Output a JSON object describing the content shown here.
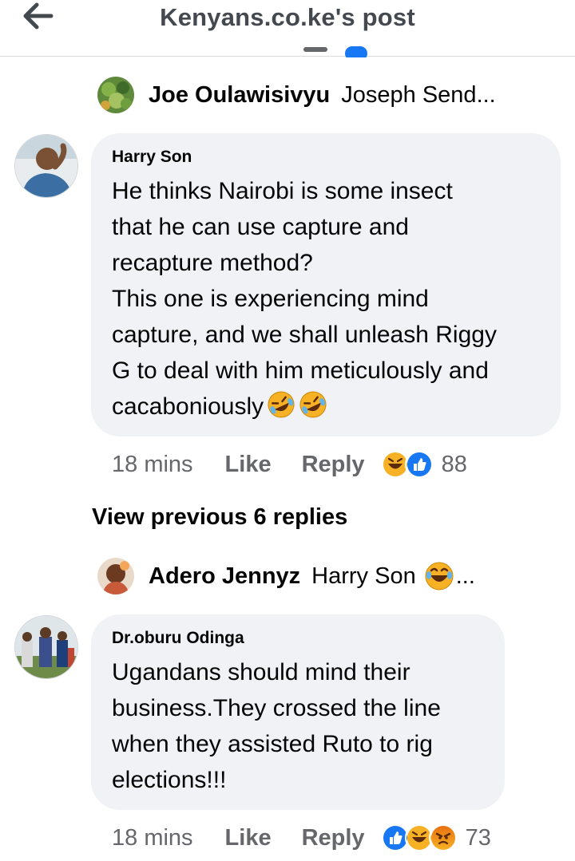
{
  "header": {
    "title": "Kenyans.co.ke's post",
    "back_icon": "arrow-left-icon"
  },
  "comments": [
    {
      "reply_preview": {
        "name": "Joe Oulawisivyu",
        "text": "Joseph Send..."
      },
      "author": "Harry Son",
      "text": "He thinks Nairobi is some insect\nthat he can use capture and\nrecapture method?\nThis one is experiencing mind\ncapture, and we shall unleash Riggy\nG to deal with him meticulously and\ncacaboniously",
      "time": "18 mins",
      "like_label": "Like",
      "reply_label": "Reply",
      "reaction_count": "88",
      "reactions": [
        "haha",
        "like"
      ]
    },
    {
      "reply_preview": {
        "name": "Adero Jennyz",
        "text": "Harry Son",
        "ellipsis": "..."
      },
      "author": "Dr.oburu Odinga",
      "text": "Ugandans should mind their\nbusiness.They crossed the line\nwhen they assisted Ruto to rig\nelections!!!",
      "time": "18 mins",
      "like_label": "Like",
      "reply_label": "Reply",
      "reaction_count": "73",
      "reactions": [
        "like",
        "haha",
        "angry"
      ]
    }
  ],
  "view_previous": "View previous 6 replies",
  "colors": {
    "bubble": "#f0f2f5",
    "meta_text": "#65676b",
    "like_blue": "#1877f2",
    "haha_yellow": "#f7b125",
    "angry_orange": "#e9710f"
  }
}
